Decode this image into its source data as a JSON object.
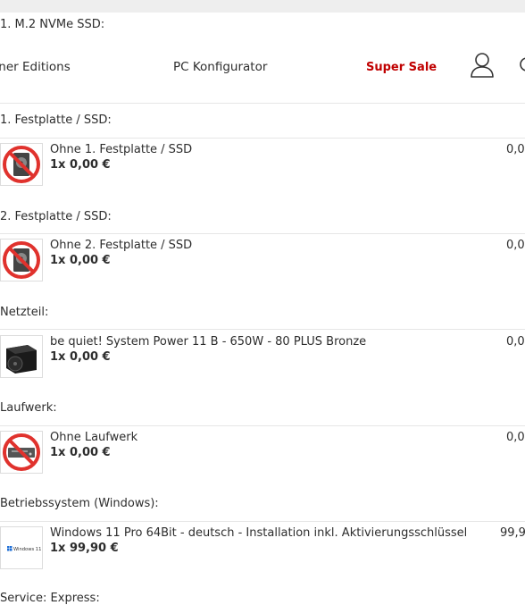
{
  "header": {
    "first_heading": "1. M.2 NVMe SSD:",
    "nav": {
      "partner": "tner Editions",
      "konfigurator": "PC Konfigurator",
      "sale": "Super Sale"
    },
    "icons": [
      "user-account-icon",
      "search-icon"
    ]
  },
  "sections": [
    {
      "heading": "1. Festplatte / SSD:",
      "item": {
        "name": "Ohne 1. Festplatte / SSD",
        "qty": "1x 0,00 €",
        "price": "0,0",
        "icon": "no-harddisk-icon"
      }
    },
    {
      "heading": "2. Festplatte / SSD:",
      "item": {
        "name": "Ohne 2. Festplatte / SSD",
        "qty": "1x 0,00 €",
        "price": "0,0",
        "icon": "no-harddisk-icon"
      }
    },
    {
      "heading": "Netzteil:",
      "item": {
        "name": "be quiet! System Power 11 B - 650W - 80 PLUS Bronze",
        "qty": "1x 0,00 €",
        "price": "0,0",
        "icon": "power-supply-icon"
      }
    },
    {
      "heading": "Laufwerk:",
      "item": {
        "name": "Ohne Laufwerk",
        "qty": "1x 0,00 €",
        "price": "0,0",
        "icon": "no-drive-icon"
      }
    },
    {
      "heading": "Betriebssystem (Windows):",
      "item": {
        "name": "Windows 11 Pro 64Bit - deutsch - Installation inkl. Aktivierungsschlüssel",
        "qty": "1x 99,90 €",
        "price": "99,9",
        "icon": "windows-logo-icon",
        "logo_text": "Windows 11"
      }
    },
    {
      "heading": "Service: Express:"
    }
  ],
  "colors": {
    "sale": "#c00000",
    "forbidden": "#e0322d",
    "windows_blue": "#1f6fd6"
  }
}
